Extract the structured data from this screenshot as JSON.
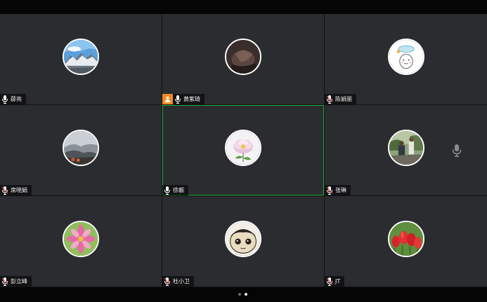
{
  "participants": [
    {
      "name": "薛亮",
      "avatar": "mountain-landscape",
      "host": false,
      "active": false,
      "muted": false
    },
    {
      "name": "黄紫琦",
      "avatar": "dark-photo",
      "host": true,
      "active": false,
      "muted": false
    },
    {
      "name": "陈娟丽",
      "avatar": "cartoon-character",
      "host": false,
      "active": false,
      "muted": true
    },
    {
      "name": "席晓娟",
      "avatar": "misty-mountains",
      "host": false,
      "active": false,
      "muted": true
    },
    {
      "name": "徐靓",
      "avatar": "peony-flower",
      "host": false,
      "active": true,
      "muted": false
    },
    {
      "name": "张琳",
      "avatar": "people-outdoors",
      "host": false,
      "active": false,
      "muted": true
    },
    {
      "name": "彭立峰",
      "avatar": "pink-cosmos-flower",
      "host": false,
      "active": false,
      "muted": true
    },
    {
      "name": "杜小卫",
      "avatar": "cartoon-face",
      "host": false,
      "active": false,
      "muted": true
    },
    {
      "name": "JT",
      "avatar": "red-tulips",
      "host": false,
      "active": false,
      "muted": true
    }
  ],
  "pagination": {
    "total_pages": 2,
    "current_page": 2
  },
  "colors": {
    "tile_bg": "#2a2c2f",
    "active_border": "#1fae3d",
    "host_badge": "#f08a24",
    "muted_mic": "#e0524a"
  }
}
